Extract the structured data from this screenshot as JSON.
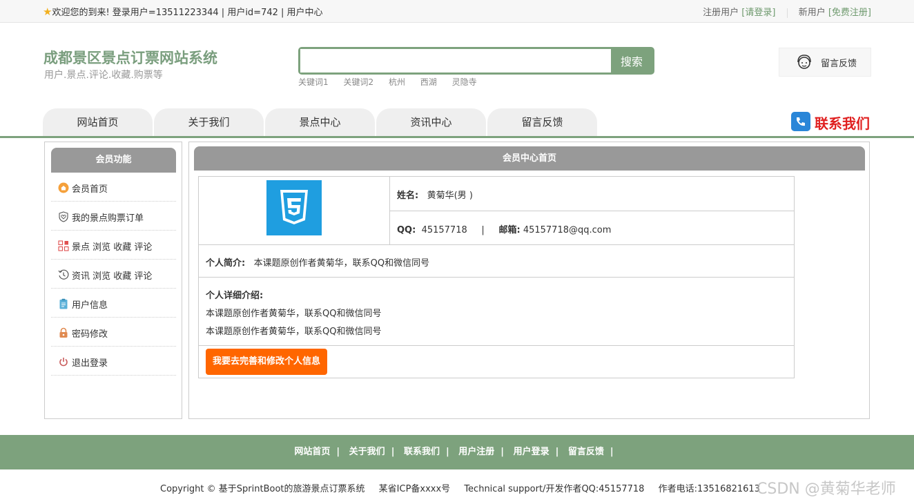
{
  "topbar": {
    "welcome": "欢迎您的到来!  登录用户=13511223344 | 用户id=742 | 用户中心",
    "register_label": "注册用户",
    "login_link": "[请登录]",
    "new_user_label": "新用户",
    "free_register_link": "[免费注册]"
  },
  "site": {
    "title": "成都景区景点订票网站系统",
    "subtitle": "用户.景点.评论.收藏.购票等"
  },
  "search": {
    "placeholder": "",
    "button_label": "搜索",
    "hotwords": [
      "关键词1",
      "关键词2",
      "杭州",
      "西湖",
      "灵隐寺"
    ]
  },
  "feedback_label": "留言反馈",
  "nav": {
    "tabs": [
      "网站首页",
      "关于我们",
      "景点中心",
      "资讯中心",
      "留言反馈"
    ],
    "contact_label": "联系我们"
  },
  "sidebar": {
    "title": "会员功能",
    "items": [
      {
        "label": "会员首页",
        "icon": "home-icon"
      },
      {
        "label": "我的景点购票订单",
        "icon": "heart-shield-icon"
      },
      {
        "label": "景点 浏览 收藏 评论",
        "icon": "grid-icon"
      },
      {
        "label": "资讯 浏览 收藏 评论",
        "icon": "history-icon"
      },
      {
        "label": "用户信息",
        "icon": "clipboard-icon"
      },
      {
        "label": "密码修改",
        "icon": "lock-icon"
      },
      {
        "label": "退出登录",
        "icon": "power-icon"
      }
    ]
  },
  "main": {
    "title": "会员中心首页",
    "name_label": "姓名:",
    "name_value": "黄菊华(男 )",
    "qq_label": "QQ:",
    "qq_value": "45157718",
    "divider": "|",
    "email_label": "邮箱:",
    "email_value": "45157718@qq.com",
    "intro_label": "个人简介:",
    "intro_value": "本课题原创作者黄菊华，联系QQ和微信同号",
    "detail_label": "个人详细介绍:",
    "detail_lines": [
      "本课题原创作者黄菊华，联系QQ和微信同号",
      "本课题原创作者黄菊华，联系QQ和微信同号"
    ],
    "edit_button": "我要去完善和修改个人信息"
  },
  "footer": {
    "links": [
      "网站首页",
      "关于我们",
      "联系我们",
      "用户注册",
      "用户登录",
      "留言反馈"
    ],
    "separator": "|",
    "copyright": "Copyright © 基于SprintBoot的旅游景点订票系统",
    "icp": "某省ICP备xxxx号",
    "support": "Technical support/开发作者QQ:45157718",
    "phone": "作者电话:13516821613"
  },
  "watermark": "CSDN @黄菊华老师",
  "colors": {
    "accent": "#7da27d",
    "button": "#ff6600",
    "header_bar": "#999999",
    "contact_red": "#e02020"
  }
}
